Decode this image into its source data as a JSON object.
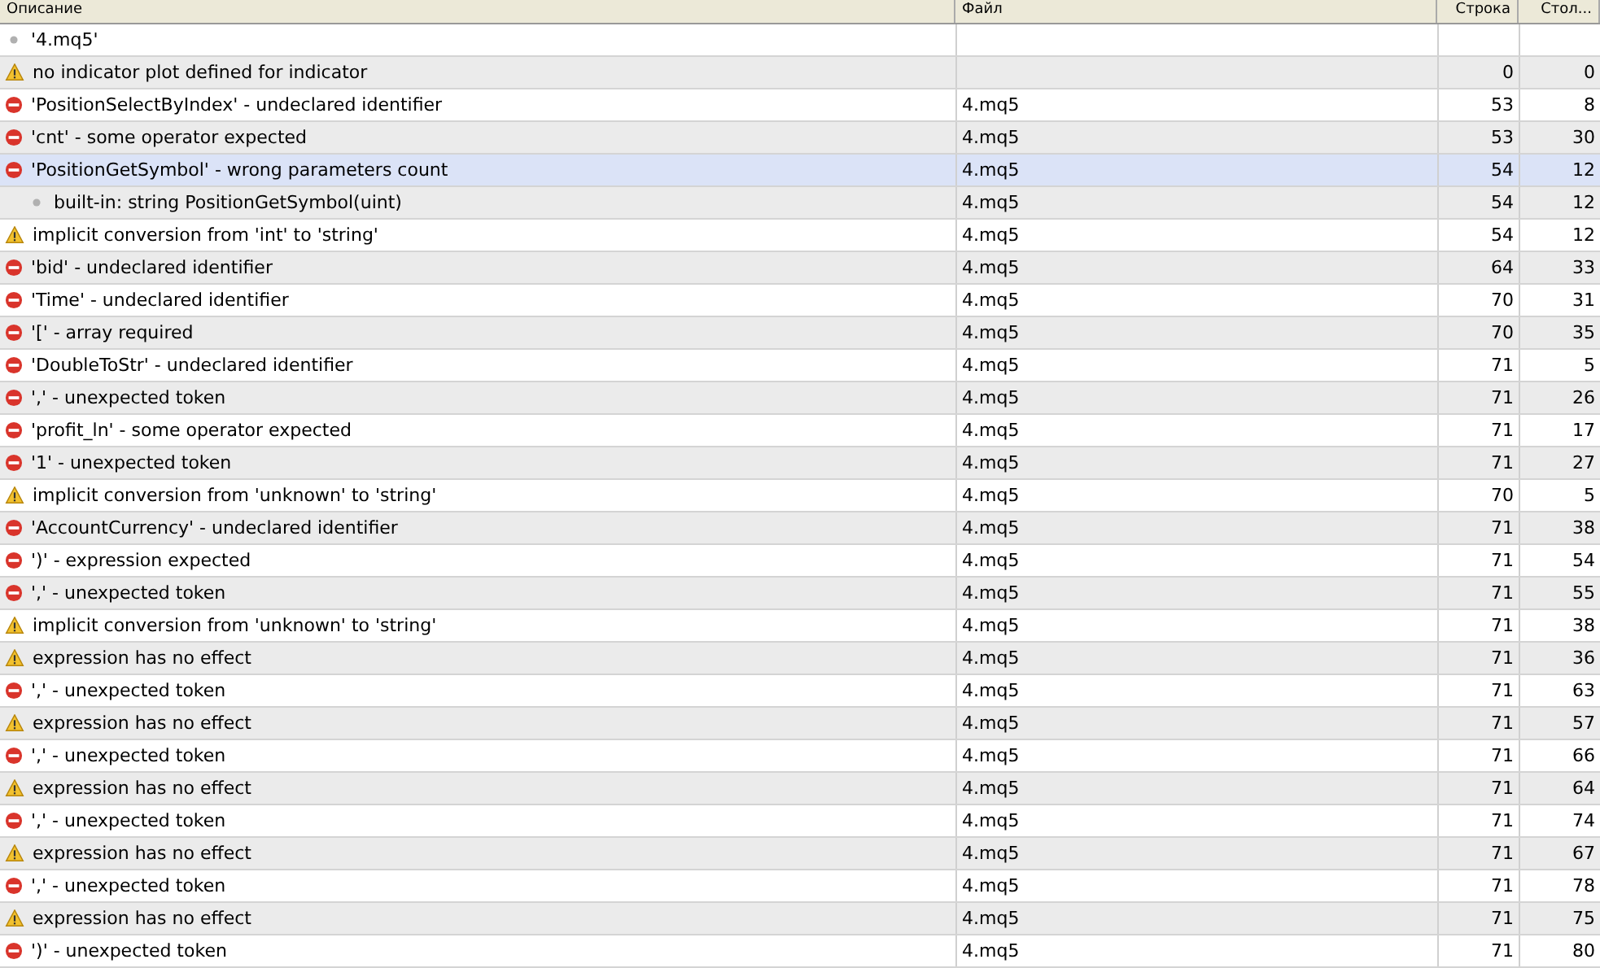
{
  "table": {
    "columns": [
      "Описание",
      "Файл",
      "Строка",
      "Стол..."
    ],
    "rows": [
      {
        "kind": "info",
        "description": "'4.mq5'",
        "file": "",
        "line": "",
        "column": "",
        "selected": false
      },
      {
        "kind": "warning",
        "description": "no indicator plot defined for indicator",
        "file": "",
        "line": "0",
        "column": "0",
        "selected": false
      },
      {
        "kind": "error",
        "description": "'PositionSelectByIndex' - undeclared identifier",
        "file": "4.mq5",
        "line": "53",
        "column": "8",
        "selected": false
      },
      {
        "kind": "error",
        "description": "'cnt' - some operator expected",
        "file": "4.mq5",
        "line": "53",
        "column": "30",
        "selected": false
      },
      {
        "kind": "error",
        "description": "'PositionGetSymbol' - wrong parameters count",
        "file": "4.mq5",
        "line": "54",
        "column": "12",
        "selected": true,
        "children": [
          {
            "kind": "info",
            "description": "built-in: string PositionGetSymbol(uint)",
            "file": "4.mq5",
            "line": "54",
            "column": "12",
            "selected": false
          }
        ]
      },
      {
        "kind": "warning",
        "description": "implicit conversion from 'int' to 'string'",
        "file": "4.mq5",
        "line": "54",
        "column": "12",
        "selected": false
      },
      {
        "kind": "error",
        "description": "'bid' - undeclared identifier",
        "file": "4.mq5",
        "line": "64",
        "column": "33",
        "selected": false
      },
      {
        "kind": "error",
        "description": "'Time' - undeclared identifier",
        "file": "4.mq5",
        "line": "70",
        "column": "31",
        "selected": false
      },
      {
        "kind": "error",
        "description": "'[' - array required",
        "file": "4.mq5",
        "line": "70",
        "column": "35",
        "selected": false
      },
      {
        "kind": "error",
        "description": "'DoubleToStr' - undeclared identifier",
        "file": "4.mq5",
        "line": "71",
        "column": "5",
        "selected": false
      },
      {
        "kind": "error",
        "description": "',' - unexpected token",
        "file": "4.mq5",
        "line": "71",
        "column": "26",
        "selected": false
      },
      {
        "kind": "error",
        "description": "'profit_ln' - some operator expected",
        "file": "4.mq5",
        "line": "71",
        "column": "17",
        "selected": false
      },
      {
        "kind": "error",
        "description": "'1' - unexpected token",
        "file": "4.mq5",
        "line": "71",
        "column": "27",
        "selected": false
      },
      {
        "kind": "warning",
        "description": "implicit conversion from 'unknown' to 'string'",
        "file": "4.mq5",
        "line": "70",
        "column": "5",
        "selected": false
      },
      {
        "kind": "error",
        "description": "'AccountCurrency' - undeclared identifier",
        "file": "4.mq5",
        "line": "71",
        "column": "38",
        "selected": false
      },
      {
        "kind": "error",
        "description": "')' - expression expected",
        "file": "4.mq5",
        "line": "71",
        "column": "54",
        "selected": false
      },
      {
        "kind": "error",
        "description": "',' - unexpected token",
        "file": "4.mq5",
        "line": "71",
        "column": "55",
        "selected": false
      },
      {
        "kind": "warning",
        "description": "implicit conversion from 'unknown' to 'string'",
        "file": "4.mq5",
        "line": "71",
        "column": "38",
        "selected": false
      },
      {
        "kind": "warning",
        "description": "expression has no effect",
        "file": "4.mq5",
        "line": "71",
        "column": "36",
        "selected": false
      },
      {
        "kind": "error",
        "description": "',' - unexpected token",
        "file": "4.mq5",
        "line": "71",
        "column": "63",
        "selected": false
      },
      {
        "kind": "warning",
        "description": "expression has no effect",
        "file": "4.mq5",
        "line": "71",
        "column": "57",
        "selected": false
      },
      {
        "kind": "error",
        "description": "',' - unexpected token",
        "file": "4.mq5",
        "line": "71",
        "column": "66",
        "selected": false
      },
      {
        "kind": "warning",
        "description": "expression has no effect",
        "file": "4.mq5",
        "line": "71",
        "column": "64",
        "selected": false
      },
      {
        "kind": "error",
        "description": "',' - unexpected token",
        "file": "4.mq5",
        "line": "71",
        "column": "74",
        "selected": false
      },
      {
        "kind": "warning",
        "description": "expression has no effect",
        "file": "4.mq5",
        "line": "71",
        "column": "67",
        "selected": false
      },
      {
        "kind": "error",
        "description": "',' - unexpected token",
        "file": "4.mq5",
        "line": "71",
        "column": "78",
        "selected": false
      },
      {
        "kind": "warning",
        "description": "expression has no effect",
        "file": "4.mq5",
        "line": "71",
        "column": "75",
        "selected": false
      },
      {
        "kind": "error",
        "description": "')' - unexpected token",
        "file": "4.mq5",
        "line": "71",
        "column": "80",
        "selected": false
      }
    ]
  }
}
